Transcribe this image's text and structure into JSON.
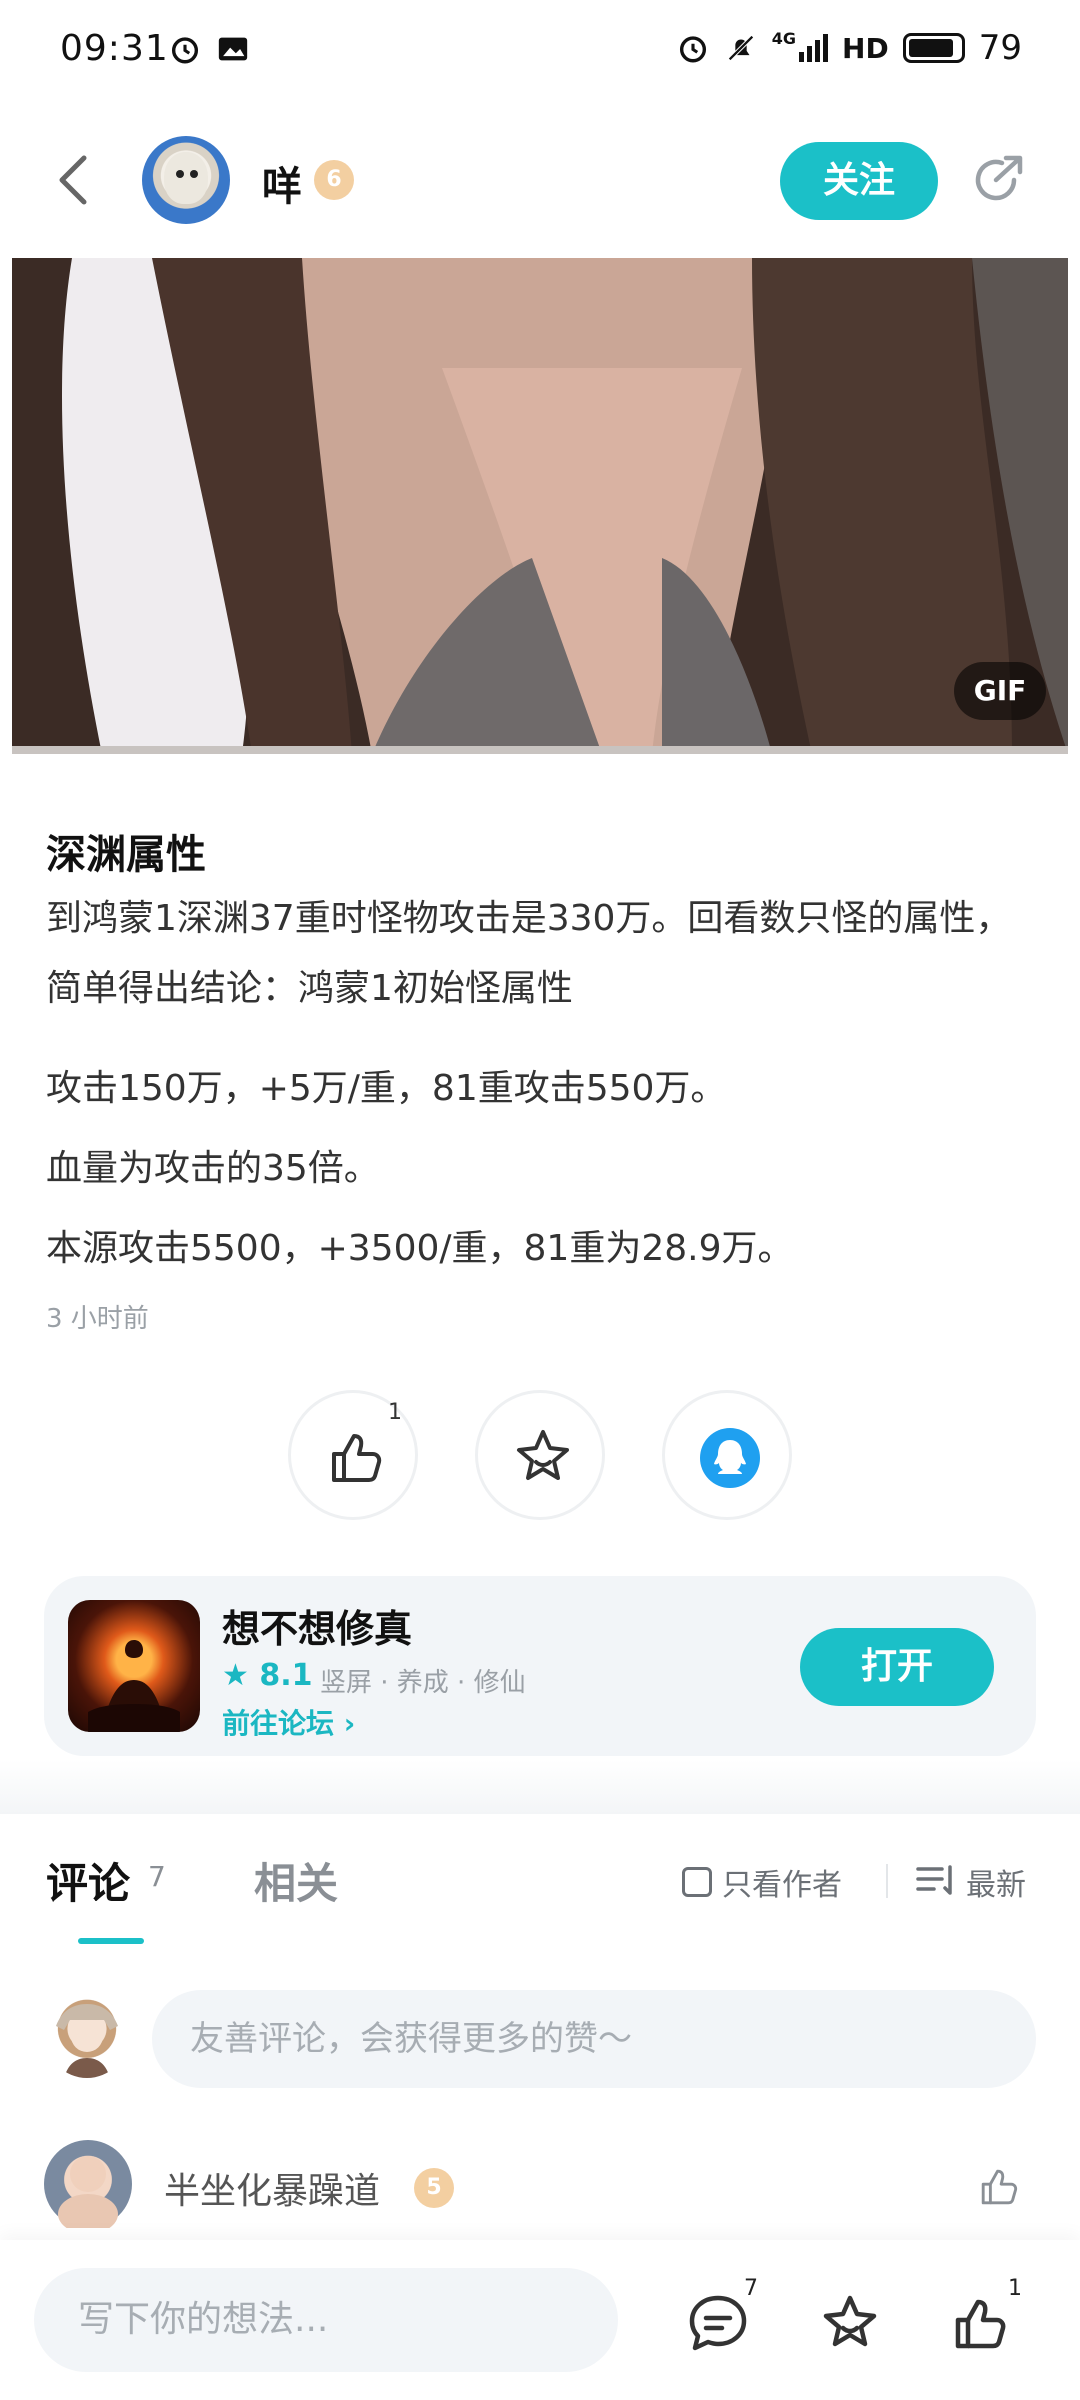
{
  "status_bar": {
    "time": "09:31",
    "network": "4G",
    "hd": "HD",
    "battery": "79"
  },
  "header": {
    "username": "咩",
    "level": "6",
    "follow_label": "关注"
  },
  "media": {
    "badge": "GIF"
  },
  "post": {
    "title": "深渊属性",
    "paragraphs": [
      "到鸿蒙1深渊37重时怪物攻击是330万。回看数只怪的属性，简单得出结论：鸿蒙1初始怪属性",
      "攻击150万，+5万/重，81重攻击550万。",
      "血量为攻击的35倍。",
      "本源攻击5500，+3500/重，81重为28.9万。"
    ],
    "time_ago": "3 小时前",
    "like_count": "1"
  },
  "game_card": {
    "name": "想不想修真",
    "rating": "8.1",
    "tags": "竖屏 · 养成 · 修仙",
    "forum_link": "前往论坛",
    "open_label": "打开"
  },
  "tabs": {
    "comments_label": "评论",
    "comments_count": "7",
    "related_label": "相关",
    "author_only_label": "只看作者",
    "sort_label": "最新"
  },
  "comment_box": {
    "placeholder": "友善评论，会获得更多的赞～"
  },
  "comments": [
    {
      "name": "半坐化暴躁道",
      "level": "5"
    }
  ],
  "bottom_bar": {
    "placeholder": "写下你的想法...",
    "comment_count": "7",
    "like_count": "1"
  },
  "colors": {
    "accent": "#1bc0c8",
    "badge": "#f3cfa1"
  }
}
